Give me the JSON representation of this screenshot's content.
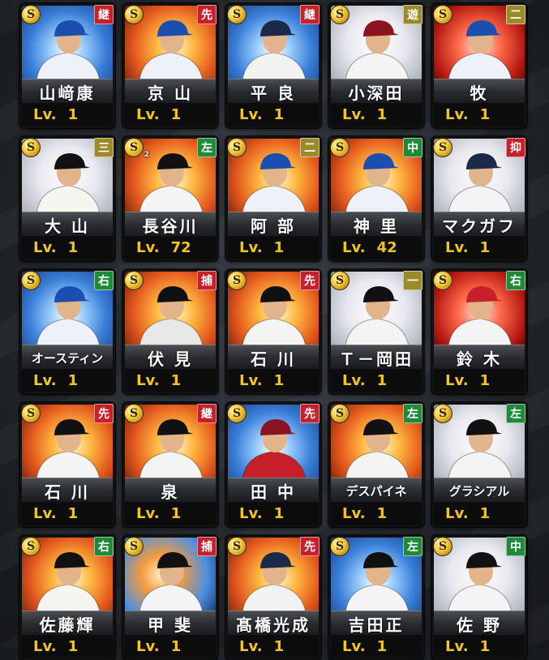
{
  "cards": [
    {
      "name": "山﨑康",
      "pos": "継",
      "pos_color": "red",
      "level": "1",
      "art": "bg-blue",
      "uniform": "#eef2f8",
      "cap": "#1a4fb0"
    },
    {
      "name": "京 山",
      "pos": "先",
      "pos_color": "red",
      "level": "1",
      "art": "bg-fire",
      "uniform": "#eef2f8",
      "cap": "#1a4fb0"
    },
    {
      "name": "平 良",
      "pos": "継",
      "pos_color": "red",
      "level": "1",
      "art": "bg-blue",
      "uniform": "#f2f2f2",
      "cap": "#1b2a4a"
    },
    {
      "name": "小深田",
      "pos": "遊",
      "pos_color": "olive",
      "level": "1",
      "art": "bg-white",
      "uniform": "#f4f4f4",
      "cap": "#8b1422"
    },
    {
      "name": "牧",
      "pos": "二",
      "pos_color": "olive",
      "level": "1",
      "art": "bg-red",
      "uniform": "#eef2f8",
      "cap": "#1a4fb0"
    },
    {
      "name": "大 山",
      "pos": "三",
      "pos_color": "olive",
      "level": "1",
      "art": "bg-white",
      "uniform": "#f6f6f0",
      "cap": "#111111"
    },
    {
      "name": "長谷川",
      "pos": "左",
      "pos_color": "green",
      "level": "72",
      "art": "bg-fire",
      "uniform": "#f4f4f4",
      "cap": "#111111",
      "s_sub": "2"
    },
    {
      "name": "阿 部",
      "pos": "二",
      "pos_color": "olive",
      "level": "1",
      "art": "bg-fire",
      "uniform": "#eef2f8",
      "cap": "#1a4fb0"
    },
    {
      "name": "神 里",
      "pos": "中",
      "pos_color": "green",
      "level": "42",
      "art": "bg-fire",
      "uniform": "#eef2f8",
      "cap": "#1a4fb0"
    },
    {
      "name": "マクガフ",
      "pos": "抑",
      "pos_color": "red",
      "level": "1",
      "art": "bg-white",
      "uniform": "#f4f4f4",
      "cap": "#1b2a4a"
    },
    {
      "name": "オースティン",
      "pos": "右",
      "pos_color": "green",
      "level": "1",
      "art": "bg-blue",
      "uniform": "#eef2f8",
      "cap": "#1a4fb0"
    },
    {
      "name": "伏 見",
      "pos": "捕",
      "pos_color": "red",
      "level": "1",
      "art": "bg-fire",
      "uniform": "#e8e8e8",
      "cap": "#111111"
    },
    {
      "name": "石 川",
      "pos": "先",
      "pos_color": "red",
      "level": "1",
      "art": "bg-fire",
      "uniform": "#f4f4f4",
      "cap": "#111111"
    },
    {
      "name": "Ｔ－岡田",
      "pos": "一",
      "pos_color": "olive",
      "level": "1",
      "art": "bg-white",
      "uniform": "#f4f4f4",
      "cap": "#111111"
    },
    {
      "name": "鈴 木",
      "pos": "右",
      "pos_color": "green",
      "level": "1",
      "art": "bg-red",
      "uniform": "#f4f4f4",
      "cap": "#c8202a"
    },
    {
      "name": "石 川",
      "pos": "先",
      "pos_color": "red",
      "level": "1",
      "art": "bg-fire",
      "uniform": "#f4f4f4",
      "cap": "#111111"
    },
    {
      "name": "泉",
      "pos": "継",
      "pos_color": "red",
      "level": "1",
      "art": "bg-fire",
      "uniform": "#f4f4f4",
      "cap": "#111111"
    },
    {
      "name": "田 中",
      "pos": "先",
      "pos_color": "red",
      "level": "1",
      "art": "bg-blue",
      "uniform": "#c8202a",
      "cap": "#8b1422"
    },
    {
      "name": "デスパイネ",
      "pos": "左",
      "pos_color": "green",
      "level": "1",
      "art": "bg-fire",
      "uniform": "#f4f4f4",
      "cap": "#111111"
    },
    {
      "name": "グラシアル",
      "pos": "左",
      "pos_color": "green",
      "level": "1",
      "art": "bg-white",
      "uniform": "#f4f4f4",
      "cap": "#111111"
    },
    {
      "name": "佐藤輝",
      "pos": "右",
      "pos_color": "green",
      "level": "1",
      "art": "bg-fire",
      "uniform": "#f6f6f0",
      "cap": "#111111"
    },
    {
      "name": "甲 斐",
      "pos": "捕",
      "pos_color": "red",
      "level": "1",
      "art": "bg-mix",
      "uniform": "#f4f4f4",
      "cap": "#111111"
    },
    {
      "name": "髙橋光成",
      "pos": "先",
      "pos_color": "red",
      "level": "1",
      "art": "bg-fire",
      "uniform": "#f2f2f2",
      "cap": "#1b2a4a"
    },
    {
      "name": "吉田正",
      "pos": "左",
      "pos_color": "green",
      "level": "1",
      "art": "bg-blue",
      "uniform": "#f4f4f4",
      "cap": "#111111"
    },
    {
      "name": "佐 野",
      "pos": "中",
      "pos_color": "green",
      "level": "1",
      "art": "bg-white",
      "uniform": "#f4f4f4",
      "cap": "#111111"
    }
  ],
  "labels": {
    "badge": "S",
    "level_prefix": "Lv."
  }
}
